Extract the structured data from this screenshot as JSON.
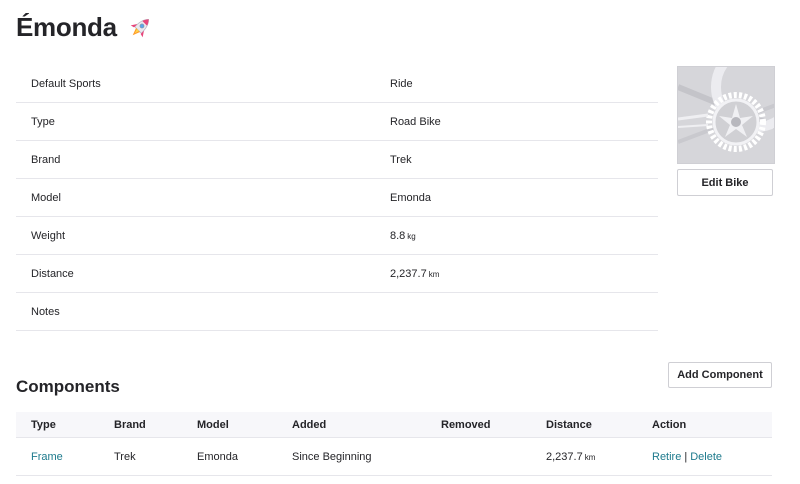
{
  "page": {
    "title": "Émonda",
    "title_icon": "rocket-icon"
  },
  "details": [
    {
      "label": "Default Sports",
      "value": "Ride",
      "unit": ""
    },
    {
      "label": "Type",
      "value": "Road Bike",
      "unit": ""
    },
    {
      "label": "Brand",
      "value": "Trek",
      "unit": ""
    },
    {
      "label": "Model",
      "value": "Emonda",
      "unit": ""
    },
    {
      "label": "Weight",
      "value": "8.8",
      "unit": "kg"
    },
    {
      "label": "Distance",
      "value": "2,237.7",
      "unit": "km"
    },
    {
      "label": "Notes",
      "value": "",
      "unit": ""
    }
  ],
  "sidebar": {
    "edit_label": "Edit Bike"
  },
  "components": {
    "title": "Components",
    "add_label": "Add Component",
    "headers": [
      "Type",
      "Brand",
      "Model",
      "Added",
      "Removed",
      "Distance",
      "Action"
    ],
    "rows": [
      {
        "type": "Frame",
        "brand": "Trek",
        "model": "Emonda",
        "added": "Since Beginning",
        "removed": "",
        "distance": "2,237.7",
        "distance_unit": "km",
        "retire_label": "Retire",
        "separator": "|",
        "delete_label": "Delete"
      }
    ]
  },
  "colors": {
    "link": "#1d7a8c",
    "text": "#242428",
    "border": "#e6e6eb"
  }
}
